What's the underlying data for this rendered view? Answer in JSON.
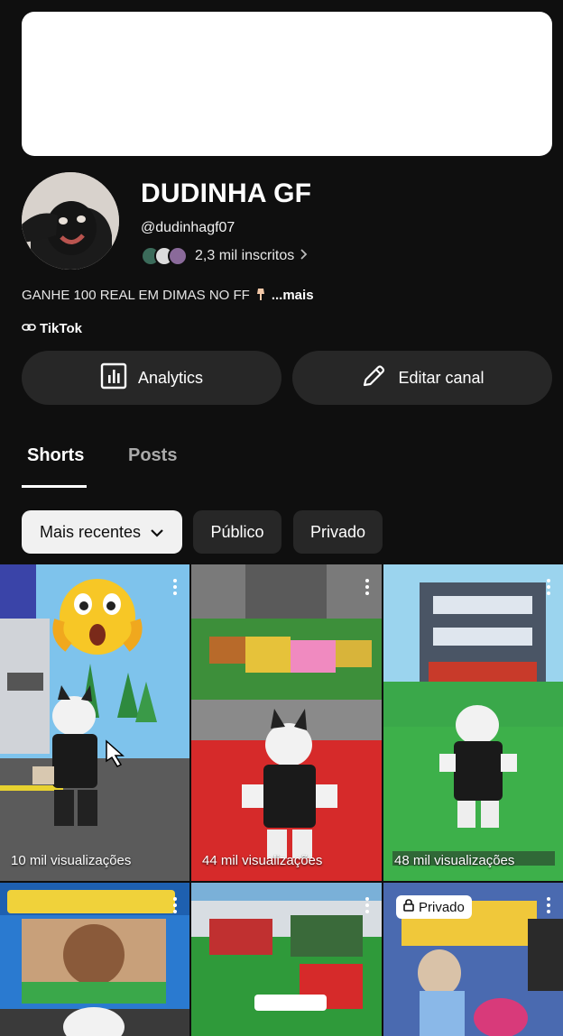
{
  "channel": {
    "name": "DUDINHA GF",
    "handle": "@dudinhagf07",
    "subscribers": "2,3 mil inscritos",
    "description": "GANHE 100 REAL EM DIMAS NO FF",
    "description_more": "...mais",
    "link_label": "TikTok"
  },
  "buttons": {
    "analytics": "Analytics",
    "edit": "Editar canal"
  },
  "tabs": {
    "shorts": "Shorts",
    "posts": "Posts"
  },
  "chips": {
    "recent": "Mais recentes",
    "public": "Público",
    "private": "Privado"
  },
  "videos": [
    {
      "views": "10 mil visualizações"
    },
    {
      "views": "44 mil visualizações"
    },
    {
      "views": "48 mil visualizações"
    },
    {
      "views": ""
    },
    {
      "views": ""
    },
    {
      "views": "",
      "badge": "Privado"
    }
  ],
  "colors": {
    "background": "#0f0f0f",
    "surface": "#272727",
    "chip_active": "#f1f1f1"
  },
  "icons": [
    "link-icon",
    "analytics-icon",
    "pencil-icon",
    "chevron-down-icon",
    "more-vert-icon",
    "lock-icon"
  ]
}
